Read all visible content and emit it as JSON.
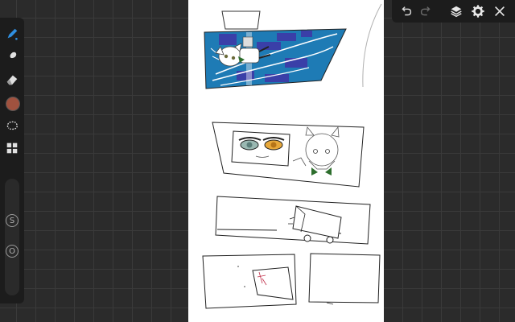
{
  "app": {
    "name": "Drawing canvas"
  },
  "toolbar_left": {
    "tools": [
      {
        "icon": "brush-icon",
        "active": true
      },
      {
        "icon": "smudge-icon"
      },
      {
        "icon": "eraser-icon"
      },
      {
        "icon": "color-swatch",
        "color": "#a0523f"
      },
      {
        "icon": "lasso-icon"
      },
      {
        "icon": "panels-icon"
      }
    ],
    "size_slider_label": "S",
    "opacity_slider_label": "O"
  },
  "toolbar_top": {
    "buttons": [
      "undo-icon",
      "redo-icon",
      "layers-icon",
      "gear-icon",
      "close-icon"
    ]
  },
  "canvas": {
    "background": "#ffffff",
    "accent": "#1e7bb5"
  }
}
